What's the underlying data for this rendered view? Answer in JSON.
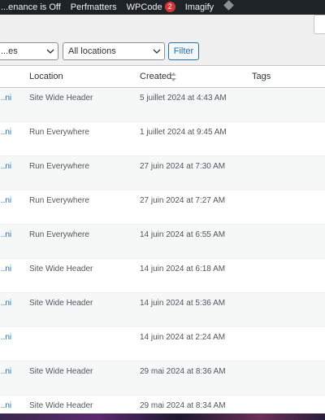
{
  "adminbar": {
    "items": [
      "...enance is Off",
      "Perfmatters",
      "WPCode",
      "Imagify"
    ],
    "wpcode_badge": "2"
  },
  "filters": {
    "type_select": "...es",
    "location_select": "All locations",
    "filter_button": "Filter"
  },
  "table": {
    "headers": {
      "location": "Location",
      "created": "Created",
      "tags": "Tags"
    },
    "rows": [
      {
        "name": "...ni",
        "location": "Site Wide Header",
        "created": "5 juillet 2024 at 4:43 AM",
        "tags": ""
      },
      {
        "name": "...ni",
        "location": "Run Everywhere",
        "created": "1 juillet 2024 at 9:45 AM",
        "tags": ""
      },
      {
        "name": "...ni",
        "location": "Run Everywhere",
        "created": "27 juin 2024 at 7:30 AM",
        "tags": ""
      },
      {
        "name": "...ni",
        "location": "Run Everywhere",
        "created": "27 juin 2024 at 7:27 AM",
        "tags": ""
      },
      {
        "name": "...ni",
        "location": "Run Everywhere",
        "created": "14 juin 2024 at 6:55 AM",
        "tags": ""
      },
      {
        "name": "...ni",
        "location": "Site Wide Header",
        "created": "14 juin 2024 at 6:18 AM",
        "tags": ""
      },
      {
        "name": "...ni",
        "location": "Site Wide Header",
        "created": "14 juin 2024 at 5:36 AM",
        "tags": ""
      },
      {
        "name": "...ni",
        "location": "",
        "created": "14 juin 2024 at 2:24 AM",
        "tags": ""
      },
      {
        "name": "...ni",
        "location": "Site Wide Header",
        "created": "29 mai 2024 at 8:36 AM",
        "tags": ""
      },
      {
        "name": "...ni",
        "location": "Site Wide Header",
        "created": "29 mai 2024 at 8:34 AM",
        "tags": ""
      }
    ]
  },
  "colors": {
    "adminbar_bg": "#1d2327",
    "accent": "#2271b1",
    "badge": "#d63638",
    "page_bg": "#f0f0f1"
  }
}
